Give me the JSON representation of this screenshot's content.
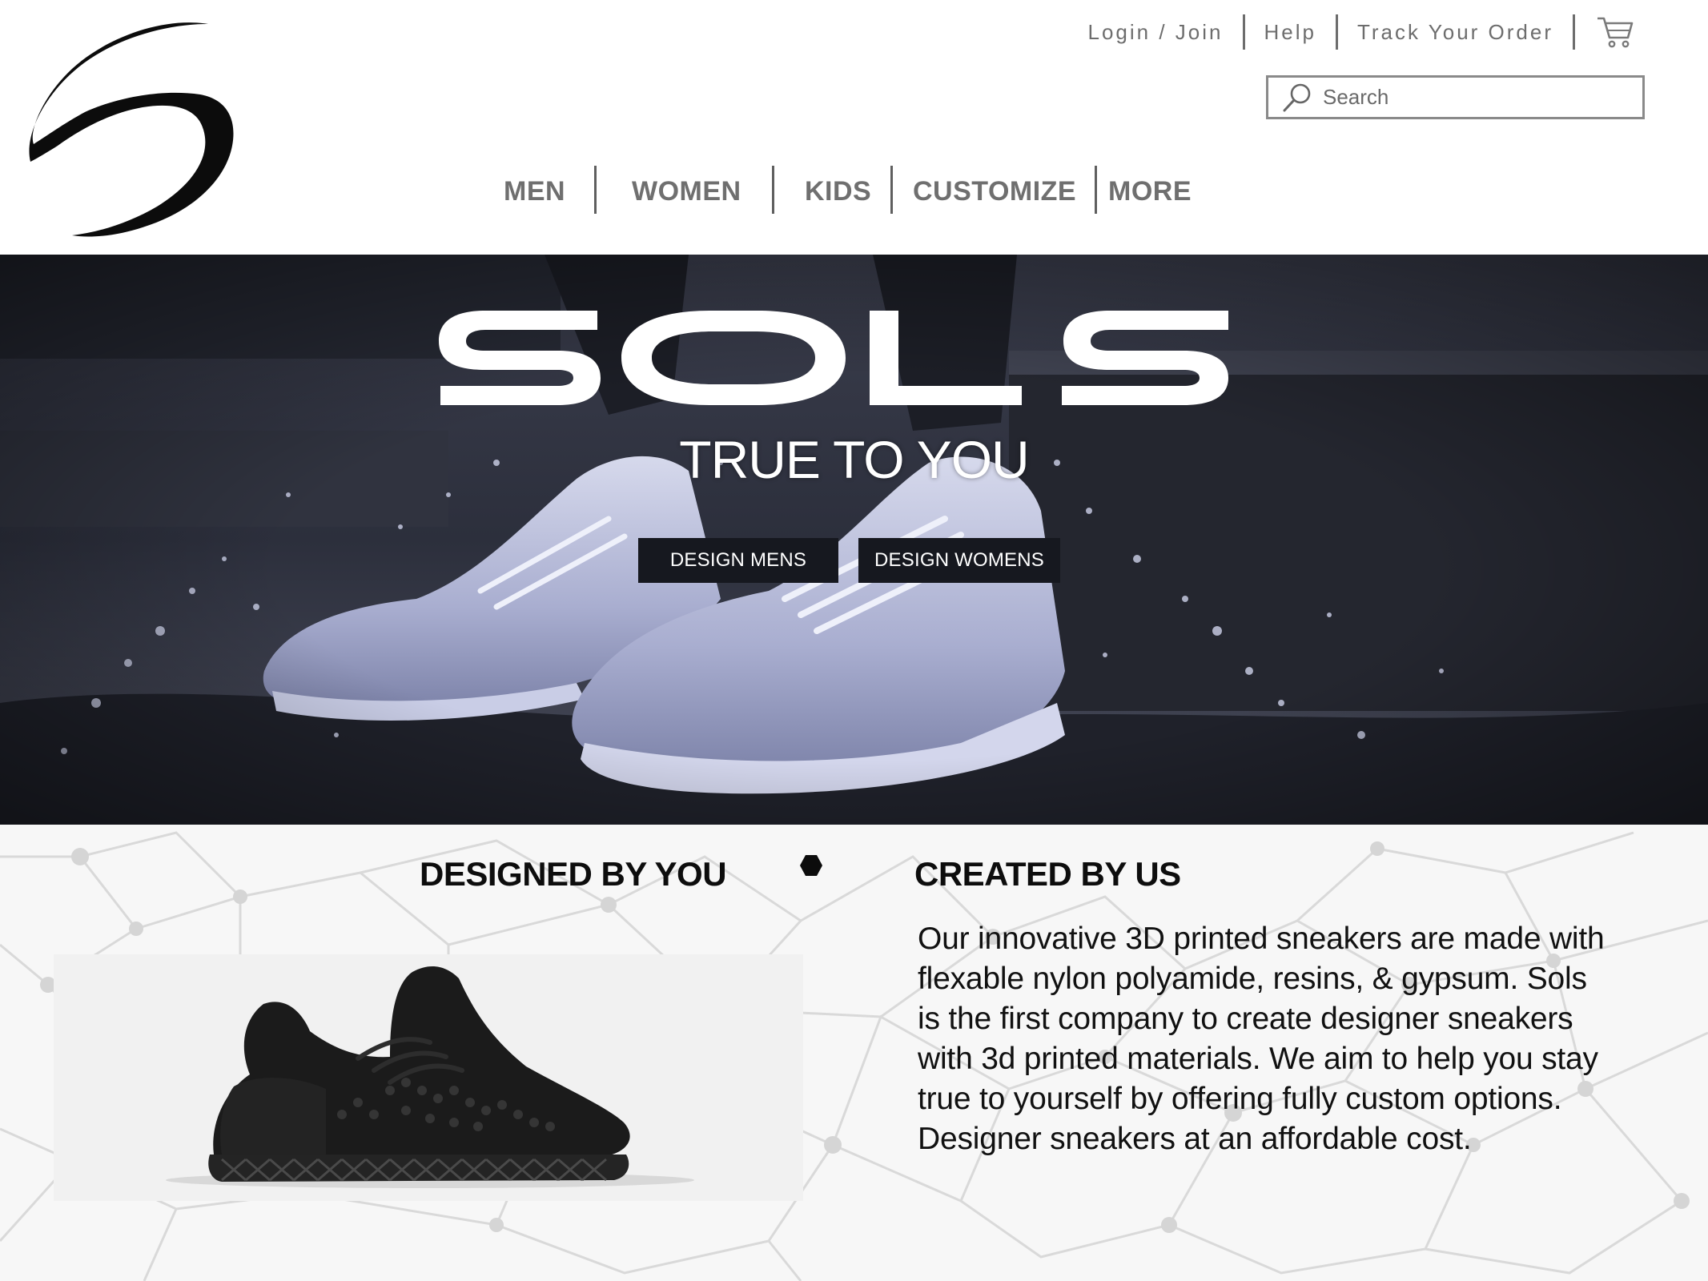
{
  "brand": {
    "logo_icon": "sols-swoosh-logo",
    "wordmark": "SOLS"
  },
  "utility_nav": {
    "login": "Login / Join",
    "help": "Help",
    "track": "Track Your Order",
    "cart_icon": "cart-icon"
  },
  "search": {
    "placeholder": "Search",
    "value": "",
    "icon": "search-icon"
  },
  "main_nav": {
    "men": "MEN",
    "women": "WOMEN",
    "kids": "KIDS",
    "customize": "CUSTOMIZE",
    "more": "MORE"
  },
  "hero": {
    "tagline": "TRUE TO YOU",
    "design_mens": "DESIGN MENS",
    "design_womens": "DESIGN WOMENS"
  },
  "features": {
    "left_heading": "DESIGNED BY YOU",
    "right_heading": "CREATED BY US",
    "description_lines": [
      "Our innovative 3D printed sneakers are made with",
      "flexable nylon polyamide, resins, & gypsum. Sols",
      "is the first company to create designer sneakers",
      "with 3d printed materials. We aim to help you stay",
      "true to yourself by offering fully custom options.",
      "Designer sneakers at an affordable cost."
    ]
  },
  "colors": {
    "nav_gray": "#6f6f6f",
    "button_dark": "#16181f",
    "hero_bg": "#2a2d3a"
  }
}
